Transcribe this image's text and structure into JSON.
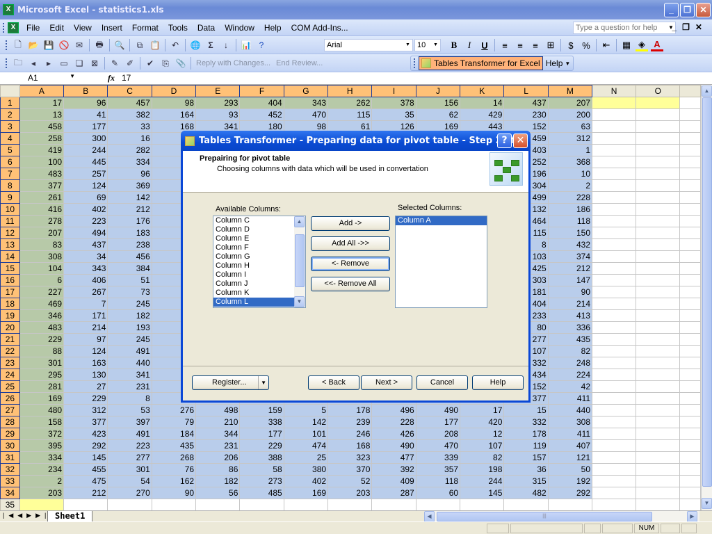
{
  "window": {
    "title": "Microsoft Excel - statistics1.xls"
  },
  "menu": [
    "File",
    "Edit",
    "View",
    "Insert",
    "Format",
    "Tools",
    "Data",
    "Window",
    "Help",
    "COM Add-Ins..."
  ],
  "help_box": {
    "placeholder": "Type a question for help"
  },
  "toolbar": {
    "font": "Arial",
    "size": "10",
    "reviewing": {
      "reply": "Reply with Changes...",
      "end_review": "End Review..."
    },
    "tables_transformer": {
      "label": "Tables Transformer for Excel",
      "help": "Help"
    }
  },
  "formula_bar": {
    "name_box": "A1",
    "fx": "fx",
    "value": "17"
  },
  "sheet": {
    "columns": [
      "A",
      "B",
      "C",
      "D",
      "E",
      "F",
      "G",
      "H",
      "I",
      "J",
      "K",
      "L",
      "M",
      "N",
      "O"
    ],
    "rows": [
      [
        17,
        96,
        457,
        98,
        293,
        404,
        343,
        262,
        378,
        156,
        14,
        437,
        207
      ],
      [
        13,
        41,
        382,
        164,
        93,
        452,
        470,
        115,
        35,
        62,
        429,
        230,
        200
      ],
      [
        458,
        177,
        33,
        168,
        341,
        180,
        98,
        61,
        126,
        169,
        443,
        152,
        63
      ],
      [
        258,
        300,
        16,
        null,
        null,
        null,
        null,
        null,
        null,
        null,
        null,
        459,
        312
      ],
      [
        419,
        244,
        282,
        null,
        null,
        null,
        null,
        null,
        null,
        null,
        null,
        403,
        1
      ],
      [
        100,
        445,
        334,
        null,
        null,
        null,
        null,
        null,
        null,
        null,
        null,
        252,
        368
      ],
      [
        483,
        257,
        96,
        null,
        null,
        null,
        null,
        null,
        null,
        null,
        null,
        196,
        10
      ],
      [
        377,
        124,
        369,
        null,
        null,
        null,
        null,
        null,
        null,
        null,
        null,
        304,
        2
      ],
      [
        261,
        69,
        142,
        null,
        null,
        null,
        null,
        null,
        null,
        null,
        null,
        499,
        228
      ],
      [
        416,
        402,
        212,
        null,
        null,
        null,
        null,
        null,
        null,
        null,
        null,
        132,
        186
      ],
      [
        278,
        223,
        176,
        null,
        null,
        null,
        null,
        null,
        null,
        null,
        null,
        464,
        118
      ],
      [
        207,
        494,
        183,
        null,
        null,
        null,
        null,
        null,
        null,
        null,
        null,
        115,
        150
      ],
      [
        83,
        437,
        238,
        null,
        null,
        null,
        null,
        null,
        null,
        null,
        null,
        8,
        432
      ],
      [
        308,
        34,
        456,
        null,
        null,
        null,
        null,
        null,
        null,
        null,
        null,
        103,
        374
      ],
      [
        104,
        343,
        384,
        null,
        null,
        null,
        null,
        null,
        null,
        null,
        null,
        425,
        212
      ],
      [
        6,
        406,
        51,
        null,
        null,
        null,
        null,
        null,
        null,
        null,
        null,
        303,
        147
      ],
      [
        227,
        267,
        73,
        null,
        null,
        null,
        null,
        null,
        null,
        null,
        null,
        181,
        90
      ],
      [
        469,
        7,
        245,
        null,
        null,
        null,
        null,
        null,
        null,
        null,
        null,
        404,
        214
      ],
      [
        346,
        171,
        182,
        null,
        null,
        null,
        null,
        null,
        null,
        null,
        null,
        233,
        413
      ],
      [
        483,
        214,
        193,
        null,
        null,
        null,
        null,
        null,
        null,
        null,
        null,
        80,
        336
      ],
      [
        229,
        97,
        245,
        null,
        null,
        null,
        null,
        null,
        null,
        null,
        null,
        277,
        435
      ],
      [
        88,
        124,
        491,
        null,
        null,
        null,
        null,
        null,
        null,
        null,
        null,
        107,
        82
      ],
      [
        301,
        163,
        440,
        null,
        null,
        null,
        null,
        null,
        null,
        null,
        null,
        332,
        248
      ],
      [
        295,
        130,
        341,
        null,
        null,
        null,
        null,
        null,
        null,
        null,
        null,
        434,
        224
      ],
      [
        281,
        27,
        231,
        null,
        null,
        null,
        null,
        null,
        null,
        null,
        null,
        152,
        42
      ],
      [
        169,
        229,
        8,
        null,
        null,
        null,
        null,
        null,
        null,
        null,
        null,
        377,
        411
      ],
      [
        480,
        312,
        53,
        276,
        498,
        159,
        5,
        178,
        496,
        490,
        17,
        15,
        440
      ],
      [
        158,
        377,
        397,
        79,
        210,
        338,
        142,
        239,
        228,
        177,
        420,
        332,
        308
      ],
      [
        372,
        423,
        491,
        184,
        344,
        177,
        101,
        246,
        426,
        208,
        12,
        178,
        411
      ],
      [
        395,
        292,
        223,
        435,
        231,
        229,
        474,
        168,
        490,
        470,
        107,
        119,
        407
      ],
      [
        334,
        145,
        277,
        268,
        206,
        388,
        25,
        323,
        477,
        339,
        82,
        157,
        121
      ],
      [
        234,
        455,
        301,
        76,
        86,
        58,
        380,
        370,
        392,
        357,
        198,
        36,
        50
      ],
      [
        2,
        475,
        54,
        162,
        182,
        273,
        402,
        52,
        409,
        118,
        244,
        315,
        192
      ],
      [
        203,
        212,
        270,
        90,
        56,
        485,
        169,
        203,
        287,
        60,
        145,
        482,
        292
      ]
    ],
    "tab": "Sheet1"
  },
  "status": {
    "num": "NUM"
  },
  "dialog": {
    "title": "Tables Transformer - Preparing data for pivot table - Step 2 of 5",
    "heading": "Prepairing for pivot table",
    "subheading": "Choosing columns with data which will be used in convertation",
    "available_label": "Available Columns:",
    "selected_label": "Selected Columns:",
    "available": [
      "Column C",
      "Column D",
      "Column E",
      "Column F",
      "Column G",
      "Column H",
      "Column I",
      "Column J",
      "Column K",
      "Column L"
    ],
    "available_selected": "Column L",
    "selected": [
      "Column A"
    ],
    "buttons": {
      "add": "Add ->",
      "add_all": "Add All ->>",
      "remove": "<- Remove",
      "remove_all": "<<- Remove All",
      "register": "Register...",
      "back": "< Back",
      "next": "Next >",
      "cancel": "Cancel",
      "help": "Help"
    }
  }
}
